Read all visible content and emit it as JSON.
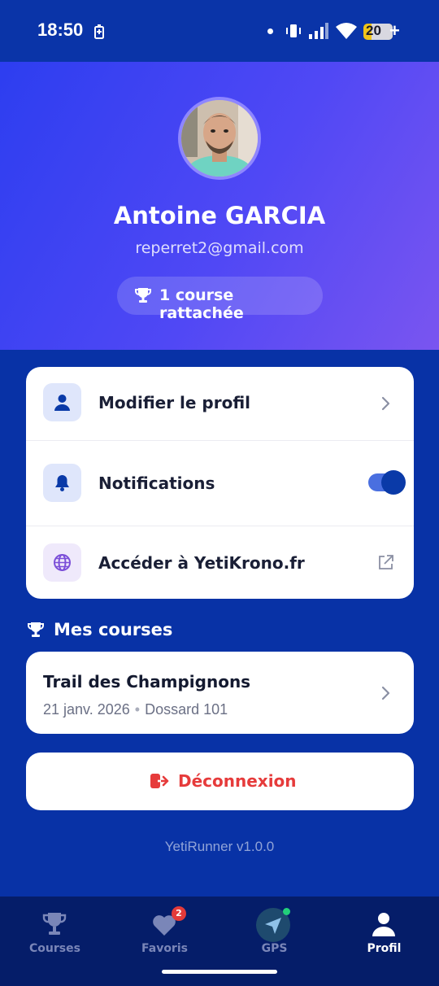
{
  "status_bar": {
    "time": "18:50",
    "battery_level": "20",
    "battery_plus": "+",
    "icons": [
      "battery-saver-icon",
      "dot-icon",
      "vibrate-icon",
      "signal-icon",
      "wifi-icon"
    ]
  },
  "profile": {
    "name": "Antoine GARCIA",
    "email": "reperret2@gmail.com",
    "courses_pill": "1 course rattachée"
  },
  "menu": {
    "edit_profile": "Modifier le profil",
    "notifications": "Notifications",
    "notifications_enabled": true,
    "website": "Accéder à YetiKrono.fr"
  },
  "races": {
    "section_title": "Mes courses",
    "items": [
      {
        "name": "Trail des Champignons",
        "date": "21 janv. 2026",
        "bib": "Dossard 101",
        "separator": "•"
      }
    ]
  },
  "logout_label": "Déconnexion",
  "version": "YetiRunner v1.0.0",
  "nav": {
    "courses": "Courses",
    "favorites": "Favoris",
    "favorites_badge": "2",
    "gps": "GPS",
    "profile": "Profil",
    "active": "profile"
  },
  "colors": {
    "background": "#0832a6",
    "header_gradient_start": "#2d3ef0",
    "header_gradient_end": "#7a55f0",
    "accent": "#0a3aa8",
    "danger": "#e63b3b"
  }
}
